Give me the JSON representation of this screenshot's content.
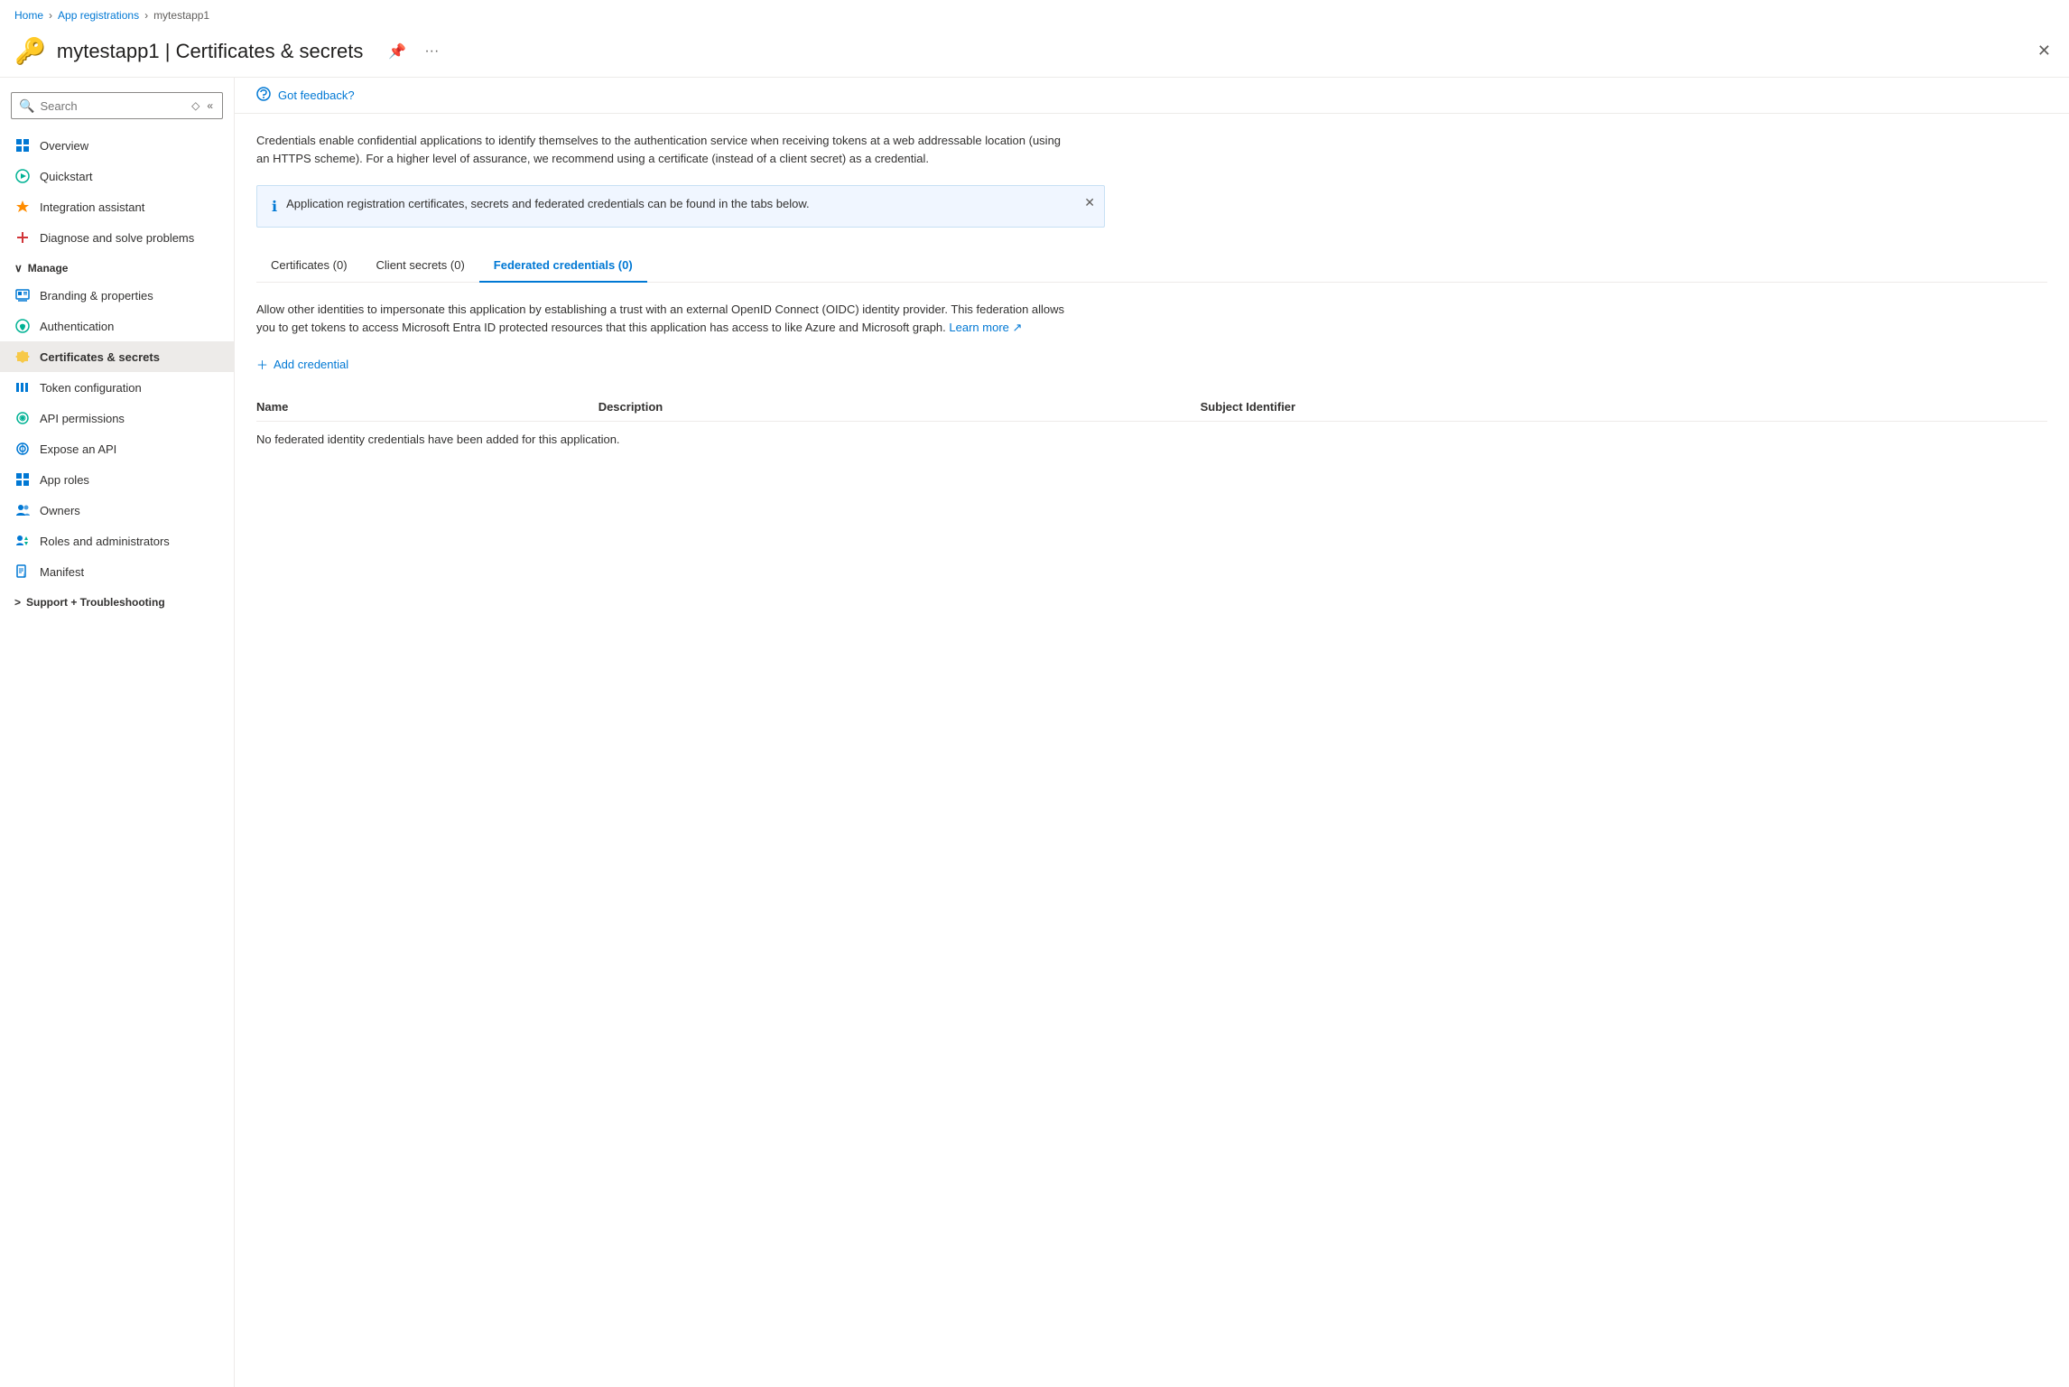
{
  "breadcrumb": {
    "home": "Home",
    "app_registrations": "App registrations",
    "app_name": "mytestapp1"
  },
  "header": {
    "icon": "🔑",
    "app_name": "mytestapp1",
    "separator": "|",
    "page_name": "Certificates & secrets",
    "pin_icon": "📌",
    "more_icon": "...",
    "close_icon": "✕"
  },
  "sidebar": {
    "search_placeholder": "Search",
    "nav_items": [
      {
        "id": "overview",
        "label": "Overview",
        "icon": "grid"
      },
      {
        "id": "quickstart",
        "label": "Quickstart",
        "icon": "quickstart"
      },
      {
        "id": "integration",
        "label": "Integration assistant",
        "icon": "rocket"
      },
      {
        "id": "diagnose",
        "label": "Diagnose and solve problems",
        "icon": "wrench"
      }
    ],
    "manage_section": "Manage",
    "manage_items": [
      {
        "id": "branding",
        "label": "Branding & properties",
        "icon": "branding"
      },
      {
        "id": "authentication",
        "label": "Authentication",
        "icon": "auth"
      },
      {
        "id": "certificates",
        "label": "Certificates & secrets",
        "icon": "cert",
        "active": true
      },
      {
        "id": "token",
        "label": "Token configuration",
        "icon": "token"
      },
      {
        "id": "api-permissions",
        "label": "API permissions",
        "icon": "api"
      },
      {
        "id": "expose-api",
        "label": "Expose an API",
        "icon": "expose"
      },
      {
        "id": "app-roles",
        "label": "App roles",
        "icon": "roles"
      },
      {
        "id": "owners",
        "label": "Owners",
        "icon": "owners"
      },
      {
        "id": "roles-admin",
        "label": "Roles and administrators",
        "icon": "roles-admin"
      },
      {
        "id": "manifest",
        "label": "Manifest",
        "icon": "manifest"
      }
    ],
    "support_section": "Support + Troubleshooting"
  },
  "content": {
    "feedback_text": "Got feedback?",
    "description": "Credentials enable confidential applications to identify themselves to the authentication service when receiving tokens at a web addressable location (using an HTTPS scheme). For a higher level of assurance, we recommend using a certificate (instead of a client secret) as a credential.",
    "info_banner": "Application registration certificates, secrets and federated credentials can be found in the tabs below.",
    "tabs": [
      {
        "id": "certificates",
        "label": "Certificates (0)"
      },
      {
        "id": "client-secrets",
        "label": "Client secrets (0)"
      },
      {
        "id": "federated",
        "label": "Federated credentials (0)",
        "active": true
      }
    ],
    "federated_description": "Allow other identities to impersonate this application by establishing a trust with an external OpenID Connect (OIDC) identity provider. This federation allows you to get tokens to access Microsoft Entra ID protected resources that this application has access to like Azure and Microsoft graph.",
    "learn_more": "Learn more",
    "add_credential": "Add credential",
    "table_headers": [
      "Name",
      "Description",
      "Subject Identifier"
    ],
    "empty_message": "No federated identity credentials have been added for this application."
  }
}
